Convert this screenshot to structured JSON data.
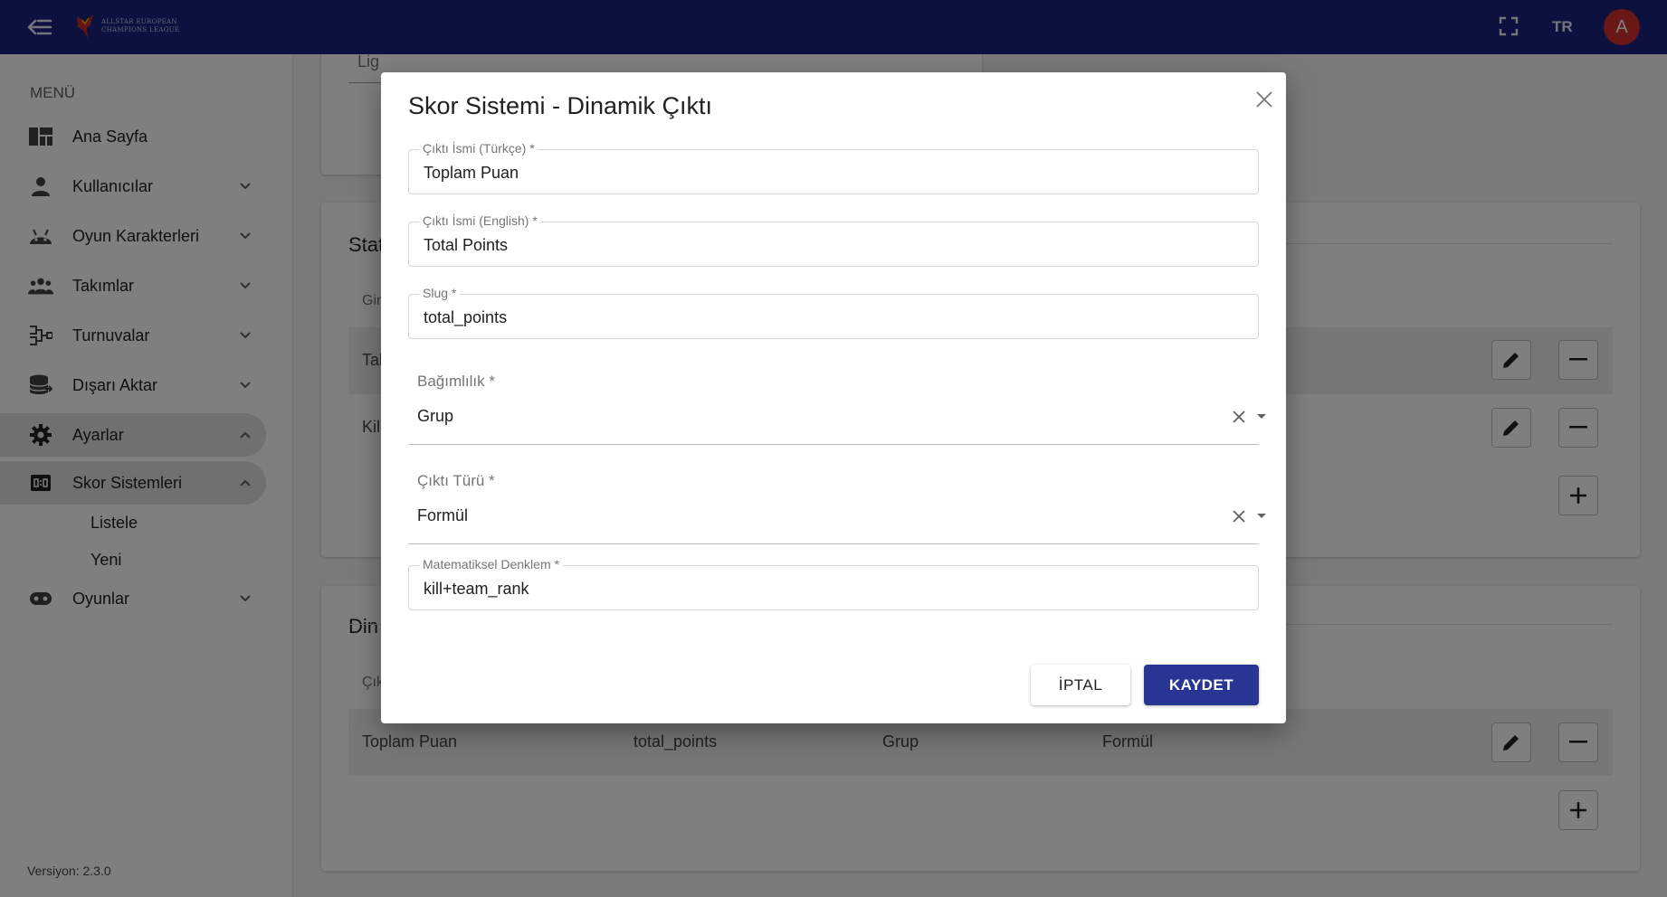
{
  "appbar": {
    "logo_line1": "ALLSTAR EUROPEAN",
    "logo_line2": "CHAMPIONS LEAGUE",
    "language": "TR",
    "avatar_letter": "A",
    "bar_color": "#1a237e"
  },
  "sidebar": {
    "menu_title": "MENÜ",
    "items": [
      {
        "label": "Ana Sayfa",
        "icon": "dashboard-icon"
      },
      {
        "label": "Kullanıcılar",
        "icon": "person-icon"
      },
      {
        "label": "Oyun Karakterleri",
        "icon": "android-icon"
      },
      {
        "label": "Takımlar",
        "icon": "group-icon"
      },
      {
        "label": "Turnuvalar",
        "icon": "bracket-icon"
      },
      {
        "label": "Dışarı Aktar",
        "icon": "database-export-icon"
      },
      {
        "label": "Ayarlar",
        "icon": "gear-icon"
      },
      {
        "label": "Skor Sistemleri",
        "icon": "scoreboard-icon"
      },
      {
        "label": "Oyunlar",
        "icon": "gamepad-icon"
      }
    ],
    "subitems": [
      "Listele",
      "Yeni"
    ],
    "version": "Versiyon: 2.3.0"
  },
  "main": {
    "league_field": "Lig",
    "stat_title": "Stat",
    "stat_header": "Gir",
    "stat_rows": [
      "Tak",
      "Kil"
    ],
    "dynamic_title": "Din",
    "dynamic_header": "Çık",
    "dynamic_row": [
      "Toplam Puan",
      "total_points",
      "Grup",
      "Formül"
    ]
  },
  "dialog": {
    "title": "Skor Sistemi - Dinamik Çıktı",
    "name_tr": {
      "label": "Çıktı İsmi (Türkçe) *",
      "value": "Toplam Puan"
    },
    "name_en": {
      "label": "Çıktı İsmi (English) *",
      "value": "Total Points"
    },
    "slug": {
      "label": "Slug *",
      "value": "total_points"
    },
    "dependency": {
      "label": "Bağımlılık *",
      "value": "Grup"
    },
    "output_type": {
      "label": "Çıktı Türü *",
      "value": "Formül"
    },
    "equation": {
      "label": "Matematiksel Denklem *",
      "value": "kill+team_rank"
    },
    "cancel_label": "İPTAL",
    "save_label": "KAYDET",
    "save_color": "#283593"
  }
}
